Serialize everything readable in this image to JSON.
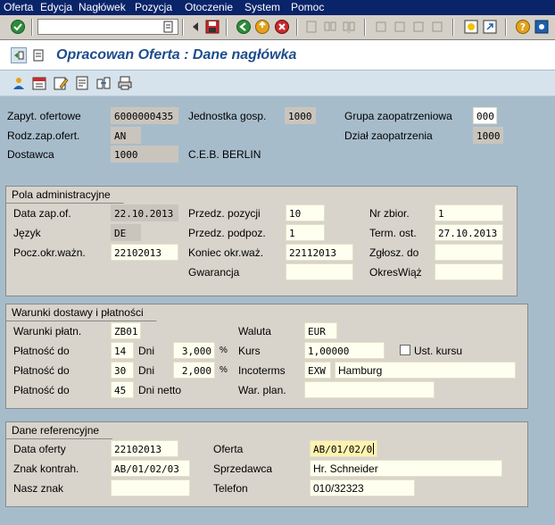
{
  "menu": [
    "Oferta",
    "Edycja",
    "Nagłówek",
    "Pozycja",
    "Otoczenie",
    "System",
    "Pomoc"
  ],
  "title": "Opracowan Oferta : Dane nagłówka",
  "header": {
    "zapyt_label": "Zapyt. ofertowe",
    "zapyt_value": "6000000435",
    "jedn_label": "Jednostka gosp.",
    "jedn_value": "1000",
    "grupa_label": "Grupa zaopatrzeniowa",
    "grupa_value": "000",
    "rodz_label": "Rodz.zap.ofert.",
    "rodz_value": "AN",
    "dzial_label": "Dział zaopatrzenia",
    "dzial_value": "1000",
    "dost_label": "Dostawca",
    "dost_value": "1000",
    "dost_name": "C.E.B. BERLIN"
  },
  "admin": {
    "title": "Pola administracyjne",
    "data_label": "Data zap.of.",
    "data_value": "22.10.2013",
    "przedz_poz_label": "Przedz. pozycji",
    "przedz_poz_value": "10",
    "nr_zbior_label": "Nr zbior.",
    "nr_zbior_value": "1",
    "jezyk_label": "Język",
    "jezyk_value": "DE",
    "przedz_podpoz_label": "Przedz. podpoz.",
    "przedz_podpoz_value": "1",
    "term_label": "Term. ost.",
    "term_value": "27.10.2013",
    "pocz_label": "Pocz.okr.ważn.",
    "pocz_value": "22102013",
    "koniec_label": "Koniec okr.waż.",
    "koniec_value": "22112013",
    "zglosz_label": "Zgłosz. do",
    "zglosz_value": "",
    "gwar_label": "Gwarancja",
    "gwar_value": "",
    "okres_label": "OkresWiąż",
    "okres_value": ""
  },
  "payment": {
    "title": "Warunki dostawy i płatności",
    "warunki_label": "Warunki płatn.",
    "warunki_value": "ZB01",
    "waluta_label": "Waluta",
    "waluta_value": "EUR",
    "pl1_label": "Płatność do",
    "pl1_days": "14",
    "dni_label": "Dni",
    "pl1_pct": "3,000",
    "pct_sign": "%",
    "kurs_label": "Kurs",
    "kurs_value": "1,00000",
    "ust_label": "Ust. kursu",
    "pl2_label": "Płatność do",
    "pl2_days": "30",
    "pl2_pct": "2,000",
    "inco_label": "Incoterms",
    "inco_code": "EXW",
    "inco_place": "Hamburg",
    "pl3_label": "Płatność do",
    "pl3_days": "45",
    "dni_netto_label": "Dni netto",
    "war_plan_label": "War. plan.",
    "war_plan_value": ""
  },
  "ref": {
    "title": "Dane referencyjne",
    "data_of_label": "Data oferty",
    "data_of_value": "22102013",
    "oferta_label": "Oferta",
    "oferta_value": "AB/01/02/0",
    "znak_k_label": "Znak kontrah.",
    "znak_k_value": "AB/01/02/03",
    "sprz_label": "Sprzedawca",
    "sprz_value": "Hr. Schneider",
    "nasz_label": "Nasz znak",
    "nasz_value": "",
    "tel_label": "Telefon",
    "tel_value": "010/32323"
  }
}
